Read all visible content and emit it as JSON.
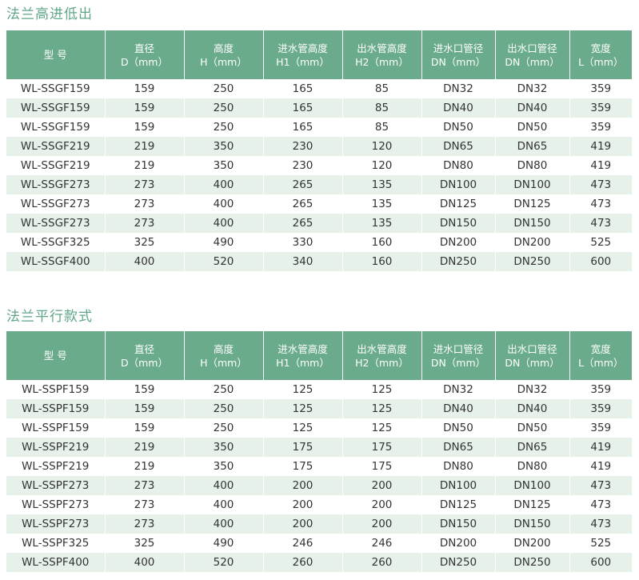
{
  "table1": {
    "title": "法兰高进低出",
    "headers": [
      {
        "l1": "型 号",
        "l2": ""
      },
      {
        "l1": "直径",
        "l2": "D（mm）"
      },
      {
        "l1": "高度",
        "l2": "H（mm）"
      },
      {
        "l1": "进水管高度",
        "l2": "H1（mm）"
      },
      {
        "l1": "出水管高度",
        "l2": "H2（mm）"
      },
      {
        "l1": "进水口管径",
        "l2": "DN（mm）"
      },
      {
        "l1": "出水口管径",
        "l2": "DN（mm）"
      },
      {
        "l1": "宽度",
        "l2": "L（mm）"
      }
    ],
    "rows": [
      [
        "WL-SSGF159",
        "159",
        "250",
        "165",
        "85",
        "DN32",
        "DN32",
        "359"
      ],
      [
        "WL-SSGF159",
        "159",
        "250",
        "165",
        "85",
        "DN40",
        "DN40",
        "359"
      ],
      [
        "WL-SSGF159",
        "159",
        "250",
        "165",
        "85",
        "DN50",
        "DN50",
        "359"
      ],
      [
        "WL-SSGF219",
        "219",
        "350",
        "230",
        "120",
        "DN65",
        "DN65",
        "419"
      ],
      [
        "WL-SSGF219",
        "219",
        "350",
        "230",
        "120",
        "DN80",
        "DN80",
        "419"
      ],
      [
        "WL-SSGF273",
        "273",
        "400",
        "265",
        "135",
        "DN100",
        "DN100",
        "473"
      ],
      [
        "WL-SSGF273",
        "273",
        "400",
        "265",
        "135",
        "DN125",
        "DN125",
        "473"
      ],
      [
        "WL-SSGF273",
        "273",
        "400",
        "265",
        "135",
        "DN150",
        "DN150",
        "473"
      ],
      [
        "WL-SSGF325",
        "325",
        "490",
        "330",
        "160",
        "DN200",
        "DN200",
        "525"
      ],
      [
        "WL-SSGF400",
        "400",
        "520",
        "340",
        "160",
        "DN250",
        "DN250",
        "600"
      ]
    ]
  },
  "table2": {
    "title": "法兰平行款式",
    "headers": [
      {
        "l1": "型 号",
        "l2": ""
      },
      {
        "l1": "直径",
        "l2": "D（mm）"
      },
      {
        "l1": "高度",
        "l2": "H（mm）"
      },
      {
        "l1": "进水管高度",
        "l2": "H1（mm）"
      },
      {
        "l1": "出水管高度",
        "l2": "H2（mm）"
      },
      {
        "l1": "进水口管径",
        "l2": "DN（mm）"
      },
      {
        "l1": "出水口管径",
        "l2": "DN（mm）"
      },
      {
        "l1": "宽度",
        "l2": "L（mm）"
      }
    ],
    "rows": [
      [
        "WL-SSPF159",
        "159",
        "250",
        "125",
        "125",
        "DN32",
        "DN32",
        "359"
      ],
      [
        "WL-SSPF159",
        "159",
        "250",
        "125",
        "125",
        "DN40",
        "DN40",
        "359"
      ],
      [
        "WL-SSPF159",
        "159",
        "250",
        "125",
        "125",
        "DN50",
        "DN50",
        "359"
      ],
      [
        "WL-SSPF219",
        "219",
        "350",
        "175",
        "175",
        "DN65",
        "DN65",
        "419"
      ],
      [
        "WL-SSPF219",
        "219",
        "350",
        "175",
        "175",
        "DN80",
        "DN80",
        "419"
      ],
      [
        "WL-SSPF273",
        "273",
        "400",
        "200",
        "200",
        "DN100",
        "DN100",
        "473"
      ],
      [
        "WL-SSPF273",
        "273",
        "400",
        "200",
        "200",
        "DN125",
        "DN125",
        "473"
      ],
      [
        "WL-SSPF273",
        "273",
        "400",
        "200",
        "200",
        "DN150",
        "DN150",
        "473"
      ],
      [
        "WL-SSPF325",
        "325",
        "490",
        "246",
        "246",
        "DN200",
        "DN200",
        "525"
      ],
      [
        "WL-SSPF400",
        "400",
        "520",
        "260",
        "260",
        "DN250",
        "DN250",
        "600"
      ]
    ]
  },
  "colors": {
    "accent": "#6aab8b",
    "title_text": "#5fa587",
    "stripe": "#e6f1ea"
  }
}
